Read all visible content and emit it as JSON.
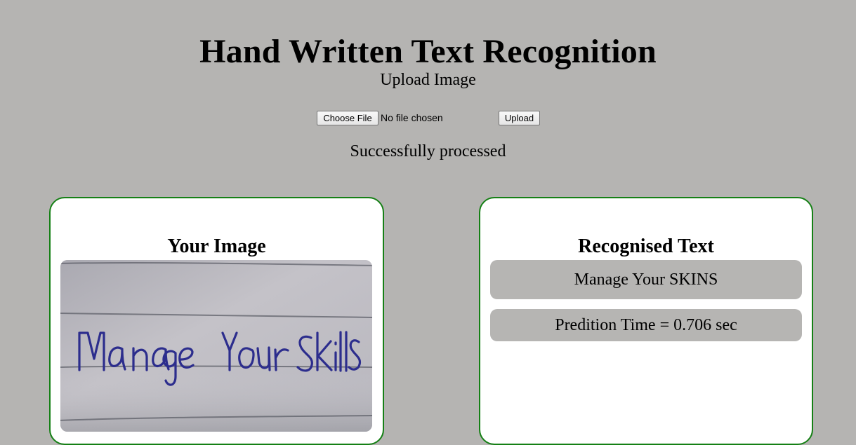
{
  "header": {
    "title": "Hand Written Text Recognition"
  },
  "upload": {
    "heading": "Upload Image",
    "choose_file_label": "Choose File",
    "file_status": "No file chosen",
    "upload_button_label": "Upload",
    "status_message": "Successfully processed"
  },
  "image_card": {
    "title": "Your Image",
    "handwritten_text": "Manage Your skills"
  },
  "result_card": {
    "title": "Recognised Text",
    "recognised_text": "Manage Your SKINS",
    "prediction_time": "Predition Time = 0.706 sec"
  },
  "colors": {
    "page_background": "#b5b4b2",
    "card_border": "#158015",
    "card_background": "#ffffff",
    "result_background": "#b6b5b3",
    "paper_background": "#bbb9bf",
    "ink": "#2c2d8d"
  },
  "icons": {
    "image": "handwritten-image"
  }
}
